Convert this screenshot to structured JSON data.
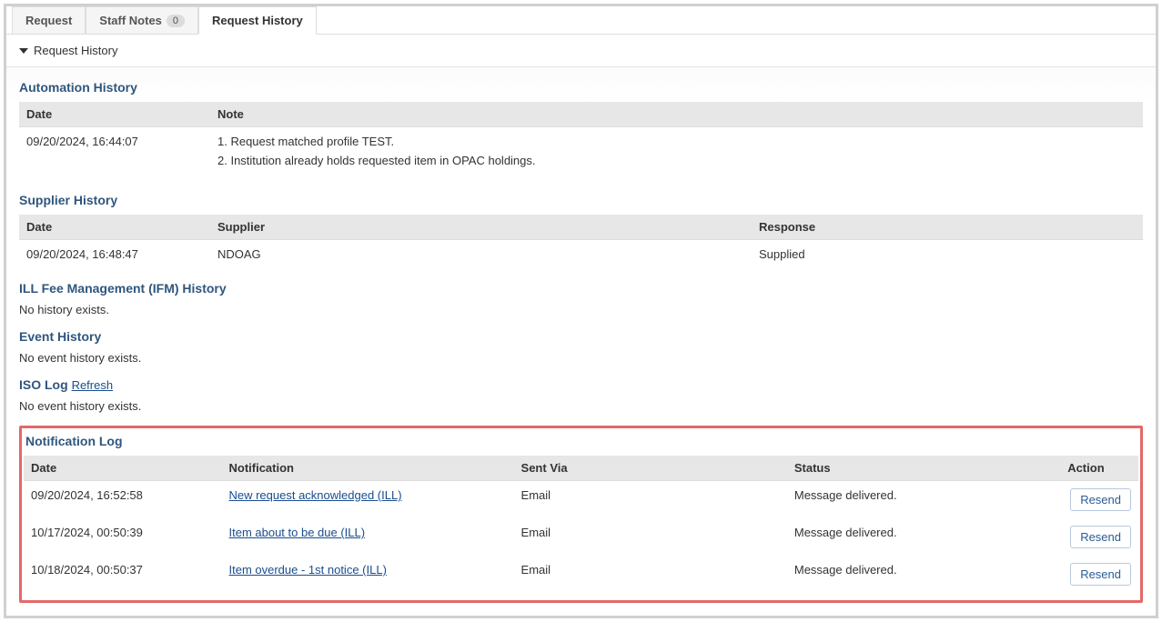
{
  "tabs": [
    {
      "label": "Request",
      "badge": null
    },
    {
      "label": "Staff Notes",
      "badge": "0"
    },
    {
      "label": "Request History",
      "badge": null
    }
  ],
  "active_tab_index": 2,
  "panel_title": "Request History",
  "sections": {
    "automation": {
      "title": "Automation History",
      "columns": {
        "date": "Date",
        "note": "Note"
      },
      "rows": [
        {
          "date": "09/20/2024, 16:44:07",
          "notes": [
            "1. Request matched profile TEST.",
            "2. Institution already holds requested item in OPAC holdings."
          ]
        }
      ]
    },
    "supplier": {
      "title": "Supplier History",
      "columns": {
        "date": "Date",
        "supplier": "Supplier",
        "response": "Response"
      },
      "rows": [
        {
          "date": "09/20/2024, 16:48:47",
          "supplier": "NDOAG",
          "response": "Supplied"
        }
      ]
    },
    "ifm": {
      "title": "ILL Fee Management (IFM) History",
      "empty_text": "No history exists."
    },
    "event": {
      "title": "Event History",
      "empty_text": "No event history exists."
    },
    "iso": {
      "title": "ISO Log",
      "refresh_label": "Refresh",
      "empty_text": "No event history exists."
    },
    "notification": {
      "title": "Notification Log",
      "columns": {
        "date": "Date",
        "notification": "Notification",
        "sent_via": "Sent Via",
        "status": "Status",
        "action": "Action"
      },
      "resend_label": "Resend",
      "rows": [
        {
          "date": "09/20/2024, 16:52:58",
          "notification": "New request acknowledged (ILL)",
          "sent_via": "Email",
          "status": "Message delivered."
        },
        {
          "date": "10/17/2024, 00:50:39",
          "notification": "Item about to be due (ILL)",
          "sent_via": "Email",
          "status": "Message delivered."
        },
        {
          "date": "10/18/2024, 00:50:37",
          "notification": "Item overdue - 1st notice (ILL)",
          "sent_via": "Email",
          "status": "Message delivered."
        }
      ]
    }
  }
}
